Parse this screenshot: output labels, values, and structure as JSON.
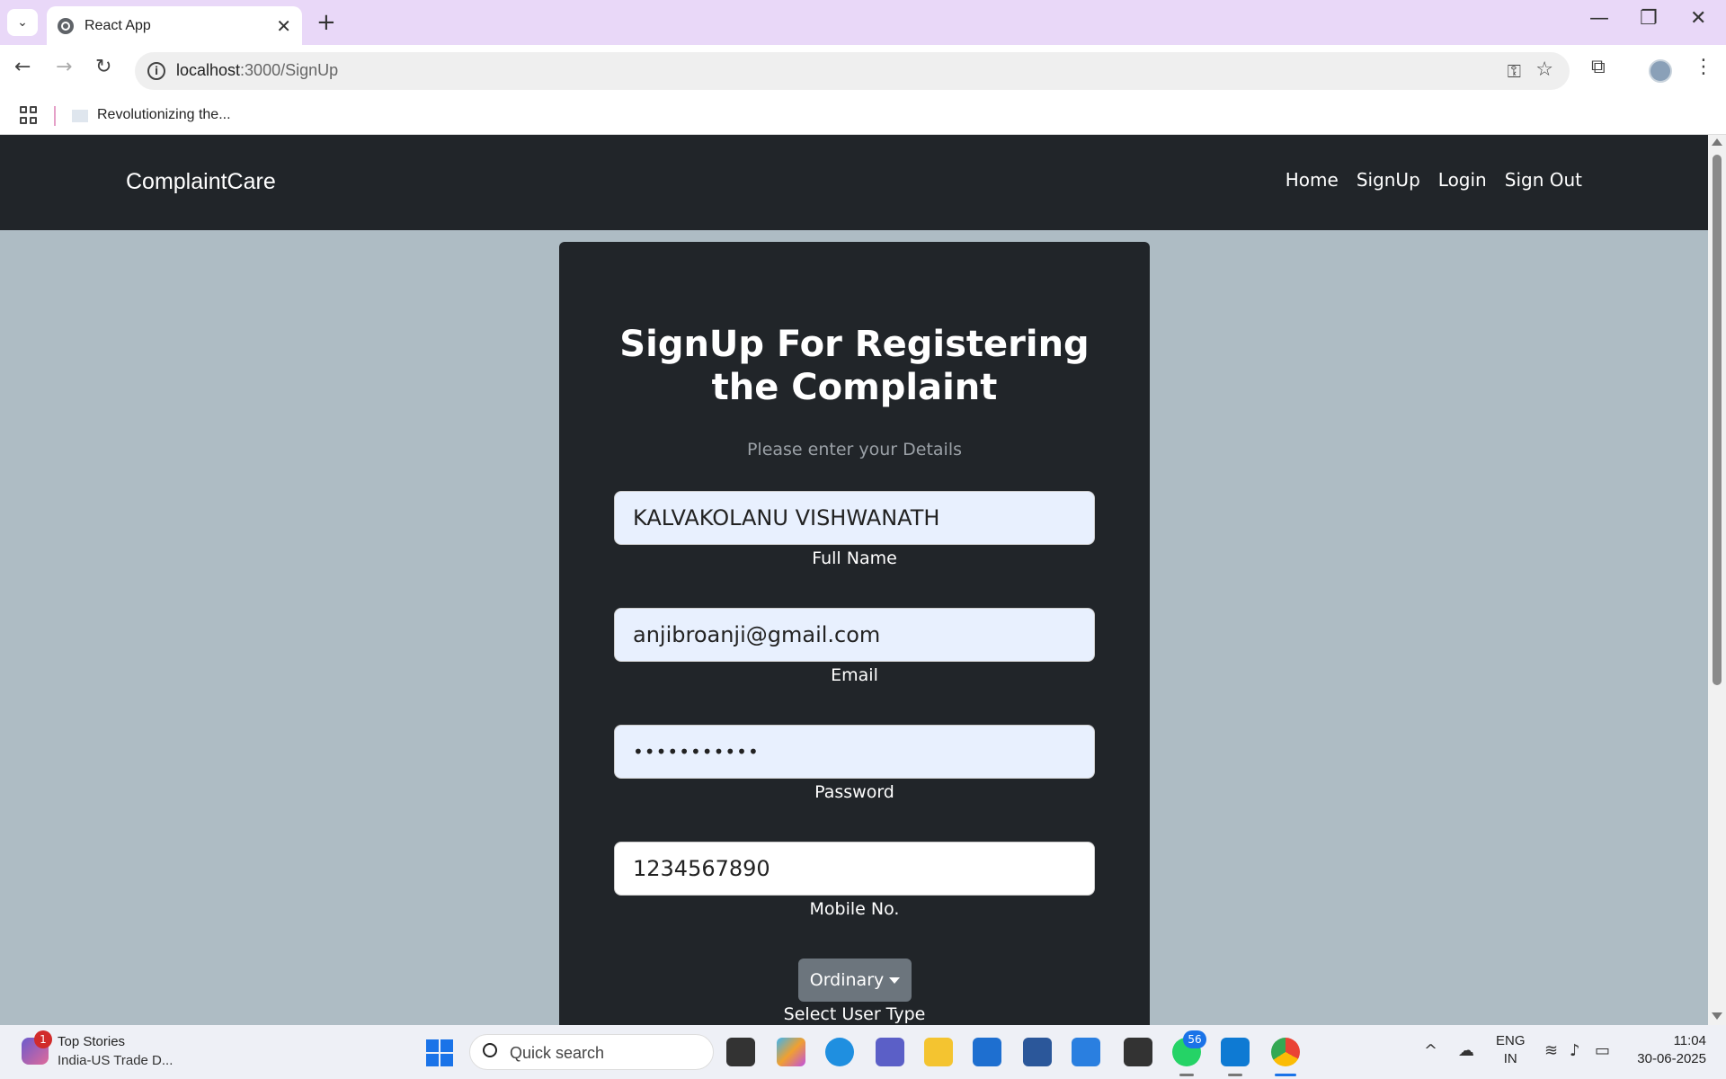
{
  "browser": {
    "tab_title": "React App",
    "url_host": "localhost",
    "url_rest": ":3000/SignUp",
    "bookmark_label": "Revolutionizing the..."
  },
  "app": {
    "brand": "ComplaintCare",
    "nav": [
      "Home",
      "SignUp",
      "Login",
      "Sign Out"
    ]
  },
  "form": {
    "title": "SignUp For Registering the Complaint",
    "subtitle": "Please enter your Details",
    "fields": [
      {
        "value": "KALVAKOLANU VISHWANATH",
        "label": "Full Name"
      },
      {
        "value": "anjibroanji@gmail.com",
        "label": "Email"
      },
      {
        "value": "•••••••••••",
        "label": "Password"
      },
      {
        "value": "1234567890",
        "label": "Mobile No."
      }
    ],
    "user_type_value": "Ordinary",
    "user_type_label": "Select User Type"
  },
  "taskbar": {
    "news_badge": "1",
    "news_title": "Top Stories",
    "news_sub": "India-US Trade D...",
    "search_placeholder": "Quick search",
    "whatsapp_badge": "56",
    "lang_line1": "ENG",
    "lang_line2": "IN",
    "time": "11:04",
    "date": "30-06-2025"
  },
  "colors": {
    "page_bg": "#aebcc4",
    "navbar_bg": "#212529",
    "card_bg": "#212529",
    "tab_strip": "#e9d8f8",
    "autofill_bg": "#e8f0fe",
    "dropdown_bg": "#6c757d"
  }
}
